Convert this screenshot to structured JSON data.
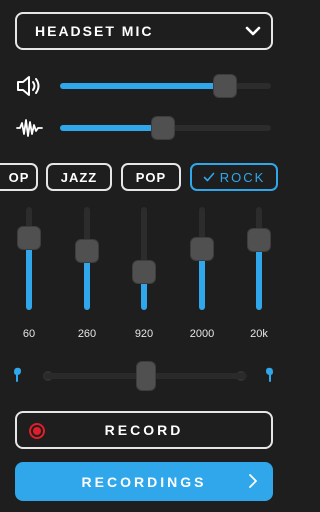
{
  "input_source": {
    "selected": "HEADSET MIC",
    "icon": "chevron-down-icon"
  },
  "volume": {
    "icon": "speaker-icon",
    "value_percent": 78
  },
  "gain": {
    "icon": "waveform-icon",
    "value_percent": 49
  },
  "presets": [
    {
      "label": "OP",
      "active": false
    },
    {
      "label": "JAZZ",
      "active": false
    },
    {
      "label": "POP",
      "active": false
    },
    {
      "label": "ROCK",
      "active": true,
      "icon": "check-icon"
    }
  ],
  "equalizer": {
    "bands": [
      {
        "freq": "60",
        "level_percent": 70
      },
      {
        "freq": "260",
        "level_percent": 57
      },
      {
        "freq": "920",
        "level_percent": 37
      },
      {
        "freq": "2000",
        "level_percent": 59
      },
      {
        "freq": "20k",
        "level_percent": 68
      }
    ]
  },
  "balance": {
    "left_icon": "left-earbud-icon",
    "right_icon": "right-earbud-icon",
    "value_percent": 50
  },
  "record_button": {
    "label": "RECORD",
    "icon": "record-icon"
  },
  "recordings_button": {
    "label": "RECORDINGS",
    "icon": "chevron-right-icon"
  },
  "colors": {
    "accent": "#2fa7ea",
    "record": "#e01e2a",
    "background": "#1e1e1e"
  }
}
